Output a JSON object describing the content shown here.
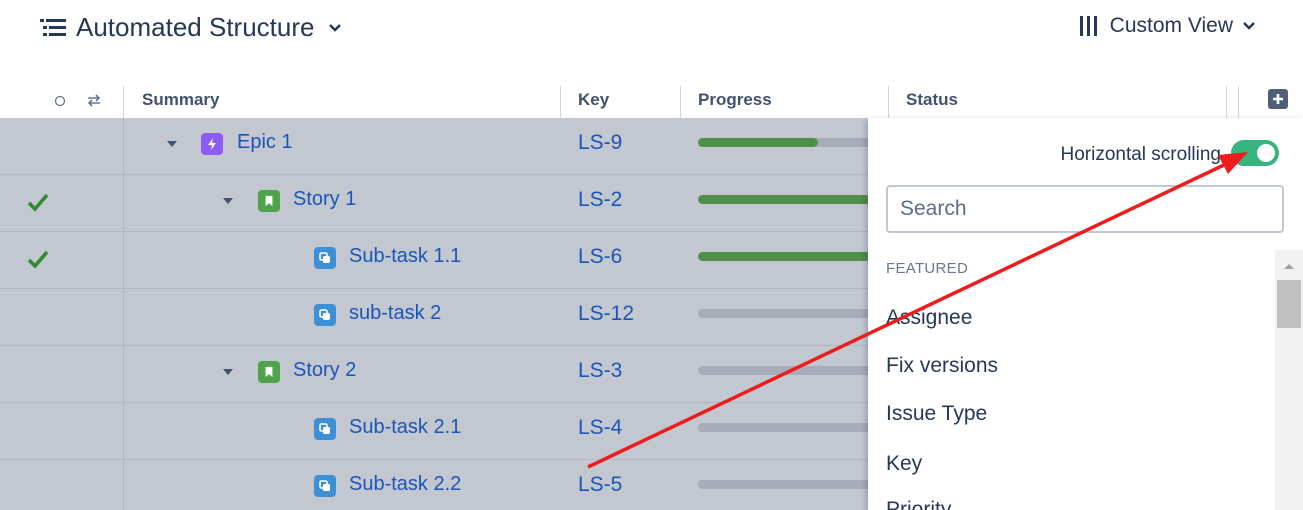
{
  "header": {
    "title": "Automated Structure",
    "custom_view": "Custom View"
  },
  "columns": {
    "summary": "Summary",
    "key": "Key",
    "progress": "Progress",
    "status": "Status"
  },
  "rows": [
    {
      "name": "Epic 1",
      "key": "LS-9",
      "type": "epic",
      "checked": false,
      "progress": 0.7
    },
    {
      "name": "Story 1",
      "key": "LS-2",
      "type": "story",
      "checked": true,
      "progress": 1.0
    },
    {
      "name": "Sub-task 1.1",
      "key": "LS-6",
      "type": "subtask",
      "checked": true,
      "progress": 1.0
    },
    {
      "name": "sub-task 2",
      "key": "LS-12",
      "type": "subtask",
      "checked": false,
      "progress": 0
    },
    {
      "name": "Story 2",
      "key": "LS-3",
      "type": "story",
      "checked": false,
      "progress": 0
    },
    {
      "name": "Sub-task 2.1",
      "key": "LS-4",
      "type": "subtask",
      "checked": false,
      "progress": 0
    },
    {
      "name": "Sub-task 2.2",
      "key": "LS-5",
      "type": "subtask",
      "checked": false,
      "progress": 0
    }
  ],
  "panel": {
    "horizontal_scrolling": "Horizontal scrolling",
    "horizontal_scrolling_on": true,
    "search_placeholder": "Search",
    "featured": "FEATURED",
    "fields": [
      "Assignee",
      "Fix versions",
      "Issue Type",
      "Key",
      "Priority"
    ]
  },
  "colors": {
    "epic": "#8b5cf6",
    "story": "#4fa34b",
    "subtask": "#3d8fd6",
    "toggle": "#36b37e",
    "arrow": "#ee1c1c",
    "link": "#1a56b8"
  },
  "icons": {
    "title": "structure-list-icon",
    "custom_view": "columns-bars-icon",
    "epic": "lightning-icon",
    "story": "bookmark-icon",
    "subtask": "subtask-icon",
    "add_column": "plus-square-icon"
  }
}
